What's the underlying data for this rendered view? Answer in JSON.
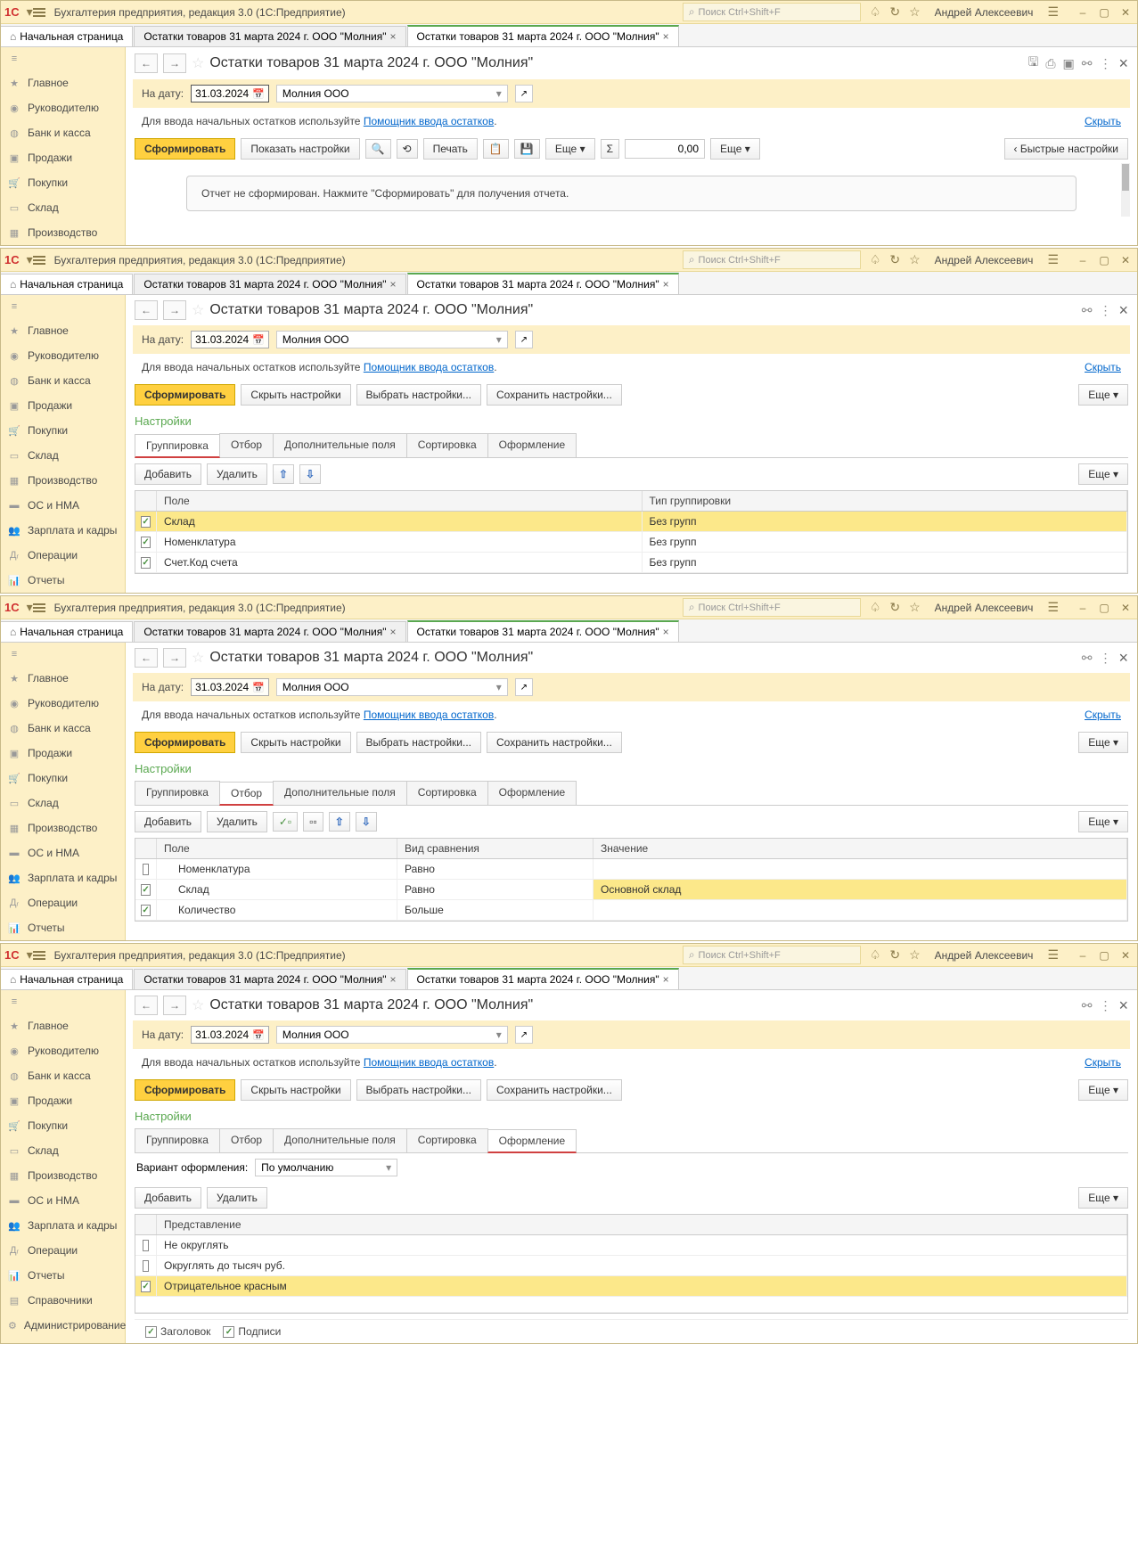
{
  "title_bar": {
    "logo": "1C",
    "app_title": "Бухгалтерия предприятия, редакция 3.0  (1С:Предприятие)",
    "search_placeholder": "Поиск Ctrl+Shift+F",
    "user": "Андрей Алексеевич"
  },
  "tabs": {
    "home": "Начальная страница",
    "t1": "Остатки товаров 31 марта 2024 г. ООО \"Молния\"",
    "t2": "Остатки товаров 31 марта 2024 г. ООО \"Молния\""
  },
  "sidebar": {
    "items": [
      "Главное",
      "Руководителю",
      "Банк и касса",
      "Продажи",
      "Покупки",
      "Склад",
      "Производство",
      "ОС и НМА",
      "Зарплата и кадры",
      "Операции",
      "Отчеты",
      "Справочники",
      "Администрирование"
    ]
  },
  "page": {
    "title": "Остатки товаров 31 марта 2024 г. ООО \"Молния\"",
    "date_label": "На дату:",
    "date": "31.03.2024",
    "org": "Молния ООО",
    "hint_text": "Для ввода начальных остатков используйте ",
    "hint_link": "Помощник ввода остатков",
    "hide": "Скрыть"
  },
  "toolbar1": {
    "generate": "Сформировать",
    "show_settings": "Показать настройки",
    "print": "Печать",
    "more1": "Еще",
    "num": "0,00",
    "more2": "Еще",
    "quick": "Быстрые настройки"
  },
  "empty_msg": "Отчет не сформирован. Нажмите \"Сформировать\" для получения отчета.",
  "toolbar2": {
    "generate": "Сформировать",
    "hide_settings": "Скрыть настройки",
    "choose": "Выбрать настройки...",
    "save": "Сохранить настройки...",
    "more": "Еще"
  },
  "settings_title": "Настройки",
  "settings_tabs": [
    "Группировка",
    "Отбор",
    "Дополнительные поля",
    "Сортировка",
    "Оформление"
  ],
  "sub_toolbar": {
    "add": "Добавить",
    "delete": "Удалить",
    "more": "Еще"
  },
  "grouping_table": {
    "head": [
      "Поле",
      "Тип группировки"
    ],
    "rows": [
      {
        "checked": true,
        "field": "Склад",
        "type": "Без групп",
        "highlight": true
      },
      {
        "checked": true,
        "field": "Номенклатура",
        "type": "Без групп"
      },
      {
        "checked": true,
        "field": "Счет.Код счета",
        "type": "Без групп"
      }
    ]
  },
  "filter_table": {
    "head": [
      "Поле",
      "Вид сравнения",
      "Значение"
    ],
    "rows": [
      {
        "checked": false,
        "field": "Номенклатура",
        "cmp": "Равно",
        "val": ""
      },
      {
        "checked": true,
        "field": "Склад",
        "cmp": "Равно",
        "val": "Основной склад",
        "hl": true
      },
      {
        "checked": true,
        "field": "Количество",
        "cmp": "Больше",
        "val": ""
      }
    ]
  },
  "design": {
    "variant_label": "Вариант оформления:",
    "variant_value": "По умолчанию",
    "head": "Представление",
    "rows": [
      {
        "checked": false,
        "label": "Не округлять"
      },
      {
        "checked": false,
        "label": "Округлять до тысяч руб."
      },
      {
        "checked": true,
        "label": "Отрицательное красным",
        "hl": true
      }
    ],
    "footer": {
      "title": "Заголовок",
      "sign": "Подписи"
    }
  }
}
